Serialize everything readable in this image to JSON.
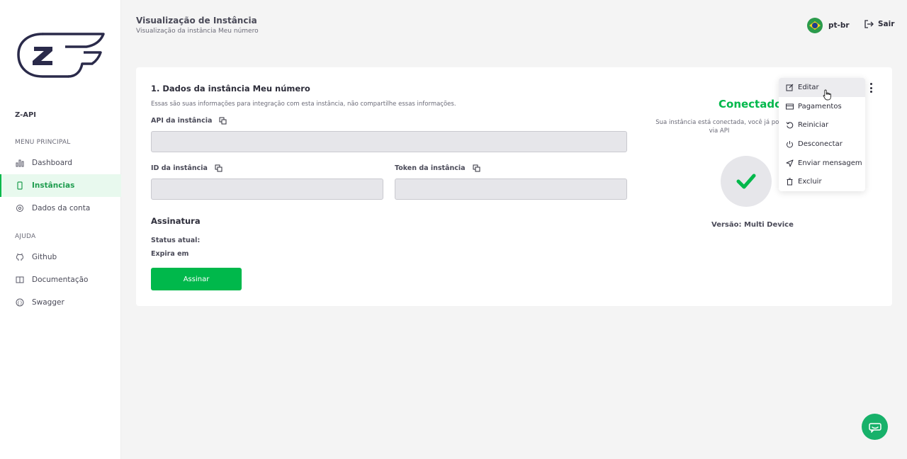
{
  "sidebar": {
    "brand": "Z-API",
    "main_menu_label": "MENU PRINCIPAL",
    "help_label": "AJUDA",
    "main_items": [
      {
        "label": "Dashboard",
        "icon": "bar-chart-icon"
      },
      {
        "label": "Instâncias",
        "icon": "phone-icon",
        "active": true
      },
      {
        "label": "Dados da conta",
        "icon": "gear-icon"
      }
    ],
    "help_items": [
      {
        "label": "Github",
        "icon": "github-icon"
      },
      {
        "label": "Documentação",
        "icon": "book-icon"
      },
      {
        "label": "Swagger",
        "icon": "swagger-icon"
      }
    ]
  },
  "header": {
    "title": "Visualização de Instância",
    "subtitle": "Visualização da instância Meu número",
    "language": "pt-br",
    "logout": "Sair"
  },
  "card": {
    "title": "1. Dados da instância Meu número",
    "description": "Essas são suas informações para integração com esta instância, não compartilhe essas informações.",
    "api_label": "API da instância",
    "api_value": "",
    "id_label": "ID da instância",
    "id_value": "",
    "token_label": "Token da instância",
    "token_value": "",
    "subscription_title": "Assinatura",
    "status_label": "Status atual:",
    "expires_label": "Expira em",
    "sign_button": "Assinar"
  },
  "status": {
    "title": "Conectado",
    "description_line1": "Sua instância está conectada, você já pod",
    "description_line2": "via API",
    "version": "Versão: Multi Device"
  },
  "menu": {
    "items": [
      {
        "label": "Editar",
        "icon": "edit-icon"
      },
      {
        "label": "Pagamentos",
        "icon": "credit-card-icon"
      },
      {
        "label": "Reiniciar",
        "icon": "restart-icon"
      },
      {
        "label": "Desconectar",
        "icon": "power-icon"
      },
      {
        "label": "Enviar mensagem",
        "icon": "send-icon"
      },
      {
        "label": "Excluir",
        "icon": "trash-icon"
      }
    ]
  },
  "colors": {
    "accent": "#00b84b",
    "active_bg": "#e8f9ee",
    "field_bg": "#e6e6ea"
  }
}
